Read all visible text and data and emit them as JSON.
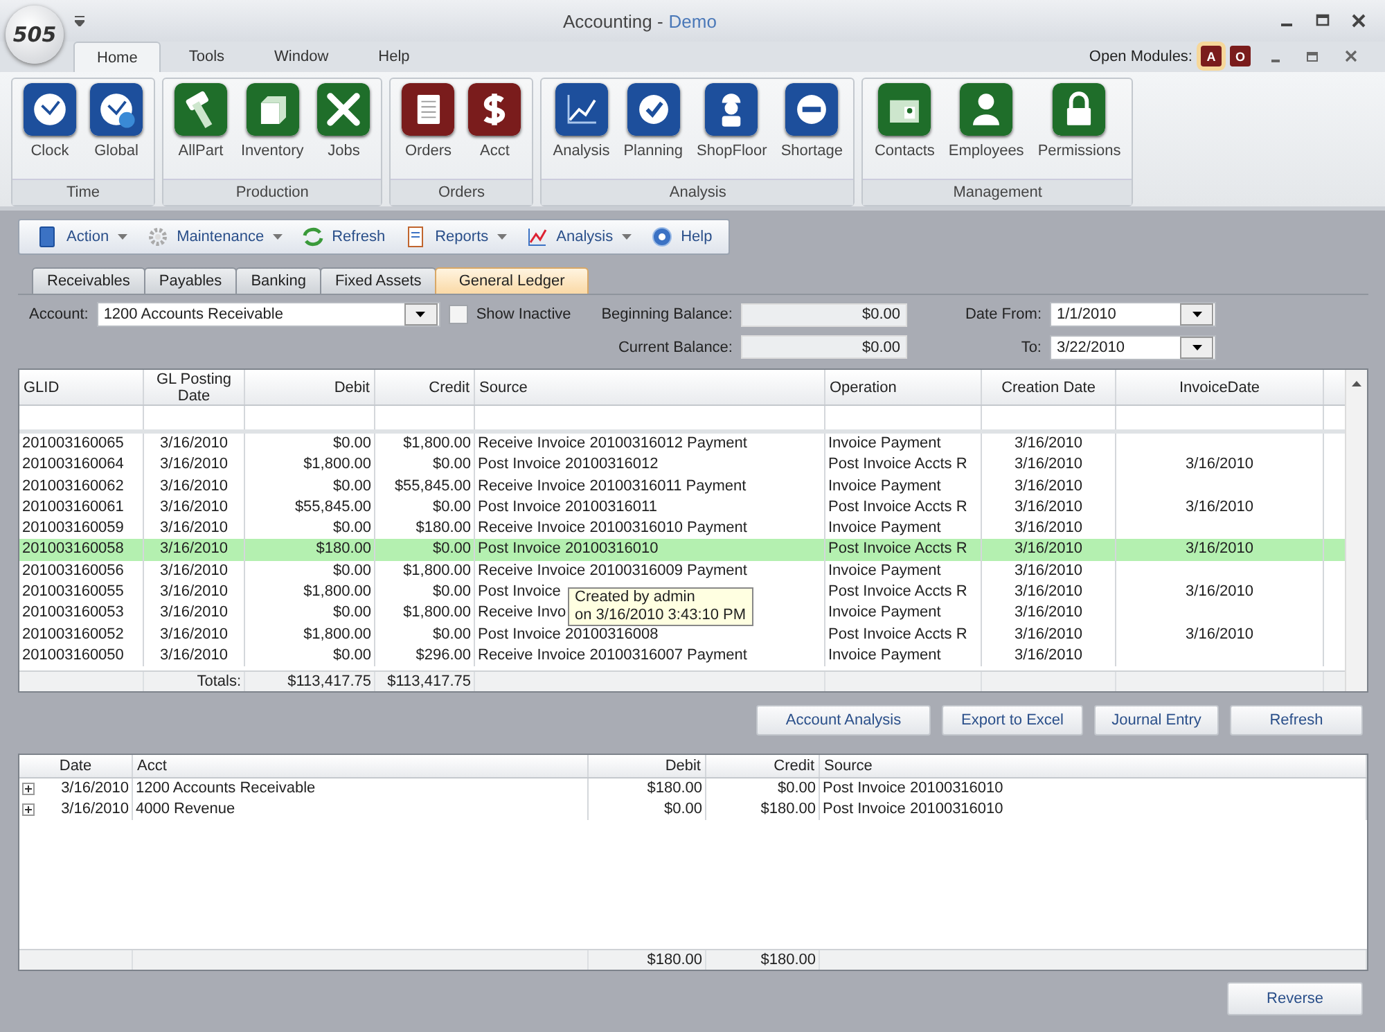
{
  "window": {
    "logo_text": "505",
    "title": "Accounting -",
    "subtitle": "Demo"
  },
  "ribbon_tabs": [
    {
      "label": "Home",
      "selected": true
    },
    {
      "label": "Tools",
      "selected": false
    },
    {
      "label": "Window",
      "selected": false
    },
    {
      "label": "Help",
      "selected": false
    }
  ],
  "open_modules": {
    "label": "Open Modules:",
    "modules": [
      {
        "label": "A",
        "selected": true
      },
      {
        "label": "O",
        "selected": false
      }
    ]
  },
  "ribbon_groups": [
    {
      "label": "Time",
      "buttons": [
        {
          "label": "Clock",
          "color": "#1d4f9c"
        },
        {
          "label": "Global",
          "color": "#1d4f9c"
        }
      ]
    },
    {
      "label": "Production",
      "buttons": [
        {
          "label": "AllPart",
          "color": "#1f6e2a"
        },
        {
          "label": "Inventory",
          "color": "#1f6e2a"
        },
        {
          "label": "Jobs",
          "color": "#1f6e2a"
        }
      ]
    },
    {
      "label": "Orders",
      "buttons": [
        {
          "label": "Orders",
          "color": "#7a1c1c"
        },
        {
          "label": "Acct",
          "color": "#7a1c1c"
        }
      ]
    },
    {
      "label": "Analysis",
      "buttons": [
        {
          "label": "Analysis",
          "color": "#1d4f9c"
        },
        {
          "label": "Planning",
          "color": "#1d4f9c"
        },
        {
          "label": "ShopFloor",
          "color": "#1d4f9c"
        },
        {
          "label": "Shortage",
          "color": "#1d4f9c"
        }
      ]
    },
    {
      "label": "Management",
      "buttons": [
        {
          "label": "Contacts",
          "color": "#1f6e2a"
        },
        {
          "label": "Employees",
          "color": "#1f6e2a"
        },
        {
          "label": "Permissions",
          "color": "#1f6e2a"
        }
      ]
    }
  ],
  "toolbar": [
    {
      "label": "Action",
      "dropdown": true
    },
    {
      "label": "Maintenance",
      "dropdown": true
    },
    {
      "label": "Refresh",
      "dropdown": false
    },
    {
      "label": "Reports",
      "dropdown": true
    },
    {
      "label": "Analysis",
      "dropdown": true
    },
    {
      "label": "Help",
      "dropdown": false
    }
  ],
  "tabs": [
    {
      "label": "Receivables",
      "selected": false
    },
    {
      "label": "Payables",
      "selected": false
    },
    {
      "label": "Banking",
      "selected": false
    },
    {
      "label": "Fixed Assets",
      "selected": false
    },
    {
      "label": "General Ledger",
      "selected": true
    }
  ],
  "filters": {
    "account_label": "Account:",
    "account": "1200 Accounts Receivable",
    "show_inactive": {
      "label": "Show Inactive",
      "checked": false
    },
    "beginning_balance_label": "Beginning Balance:",
    "beginning_balance": "$0.00",
    "current_balance_label": "Current Balance:",
    "current_balance": "$0.00",
    "date_from_label": "Date From:",
    "date_from": "1/1/2010",
    "date_to_label": "To:",
    "date_to": "3/22/2010"
  },
  "ledger": {
    "columns": [
      "GLID",
      "GL Posting Date",
      "Debit",
      "Credit",
      "Source",
      "Operation",
      "Creation Date",
      "InvoiceDate"
    ],
    "rows": [
      {
        "glid": "201003160065",
        "posting_date": "3/16/2010",
        "debit": "$0.00",
        "credit": "$1,800.00",
        "source": "Receive Invoice 20100316012 Payment",
        "operation": "Invoice Payment",
        "creation_date": "3/16/2010",
        "selected": false
      },
      {
        "glid": "201003160064",
        "posting_date": "3/16/2010",
        "debit": "$1,800.00",
        "credit": "$0.00",
        "source": "Post Invoice 20100316012",
        "operation": "Post Invoice Accts R",
        "creation_date": "3/16/2010",
        "invoice_date": "3/16/2010",
        "selected": false
      },
      {
        "glid": "201003160062",
        "posting_date": "3/16/2010",
        "debit": "$0.00",
        "credit": "$55,845.00",
        "source": "Receive Invoice 20100316011 Payment",
        "operation": "Invoice Payment",
        "creation_date": "3/16/2010",
        "selected": false
      },
      {
        "glid": "201003160061",
        "posting_date": "3/16/2010",
        "debit": "$55,845.00",
        "credit": "$0.00",
        "source": "Post Invoice 20100316011",
        "operation": "Post Invoice Accts R",
        "creation_date": "3/16/2010",
        "invoice_date": "3/16/2010",
        "selected": false
      },
      {
        "glid": "201003160059",
        "posting_date": "3/16/2010",
        "debit": "$0.00",
        "credit": "$180.00",
        "source": "Receive Invoice 20100316010 Payment",
        "operation": "Invoice Payment",
        "creation_date": "3/16/2010",
        "selected": false
      },
      {
        "glid": "201003160058",
        "posting_date": "3/16/2010",
        "debit": "$180.00",
        "credit": "$0.00",
        "source": "Post Invoice 20100316010",
        "operation": "Post Invoice Accts R",
        "creation_date": "3/16/2010",
        "invoice_date": "3/16/2010",
        "selected": true
      },
      {
        "glid": "201003160056",
        "posting_date": "3/16/2010",
        "debit": "$0.00",
        "credit": "$1,800.00",
        "source": "Receive Invoice 20100316009 Payment",
        "operation": "Invoice Payment",
        "creation_date": "3/16/2010",
        "selected": false
      },
      {
        "glid": "201003160055",
        "posting_date": "3/16/2010",
        "debit": "$1,800.00",
        "credit": "$0.00",
        "source": "Post Invoice",
        "operation": "Post Invoice Accts R",
        "creation_date": "3/16/2010",
        "invoice_date": "3/16/2010",
        "selected": false
      },
      {
        "glid": "201003160053",
        "posting_date": "3/16/2010",
        "debit": "$0.00",
        "credit": "$1,800.00",
        "source": "Receive Invo",
        "operation": "Invoice Payment",
        "creation_date": "3/16/2010",
        "selected": false
      },
      {
        "glid": "201003160052",
        "posting_date": "3/16/2010",
        "debit": "$1,800.00",
        "credit": "$0.00",
        "source": "Post Invoice 20100316008",
        "operation": "Post Invoice Accts R",
        "creation_date": "3/16/2010",
        "invoice_date": "3/16/2010",
        "selected": false
      },
      {
        "glid": "201003160050",
        "posting_date": "3/16/2010",
        "debit": "$0.00",
        "credit": "$296.00",
        "source": "Receive Invoice 20100316007 Payment",
        "operation": "Invoice Payment",
        "creation_date": "3/16/2010",
        "selected": false
      }
    ],
    "totals": {
      "label": "Totals:",
      "debit": "$113,417.75",
      "credit": "$113,417.75"
    },
    "tooltip": {
      "lines": [
        "Created by admin",
        "on 3/16/2010 3:43:10 PM"
      ]
    }
  },
  "actions": [
    "Account Analysis",
    "Export to Excel",
    "Journal Entry",
    "Refresh"
  ],
  "entries": {
    "columns": [
      "Date",
      "Acct",
      "Debit",
      "Credit",
      "Source"
    ],
    "rows": [
      {
        "date": "3/16/2010",
        "acct": "1200 Accounts Receivable",
        "debit": "$180.00",
        "credit": "$0.00",
        "source": "Post Invoice 20100316010",
        "expanded": false
      },
      {
        "date": "3/16/2010",
        "acct": "4000 Revenue",
        "debit": "$0.00",
        "credit": "$180.00",
        "source": "Post Invoice 20100316010",
        "expanded": false
      }
    ],
    "totals": {
      "debit": "$180.00",
      "credit": "$180.00"
    }
  },
  "footer_buttons": [
    "Reverse"
  ]
}
